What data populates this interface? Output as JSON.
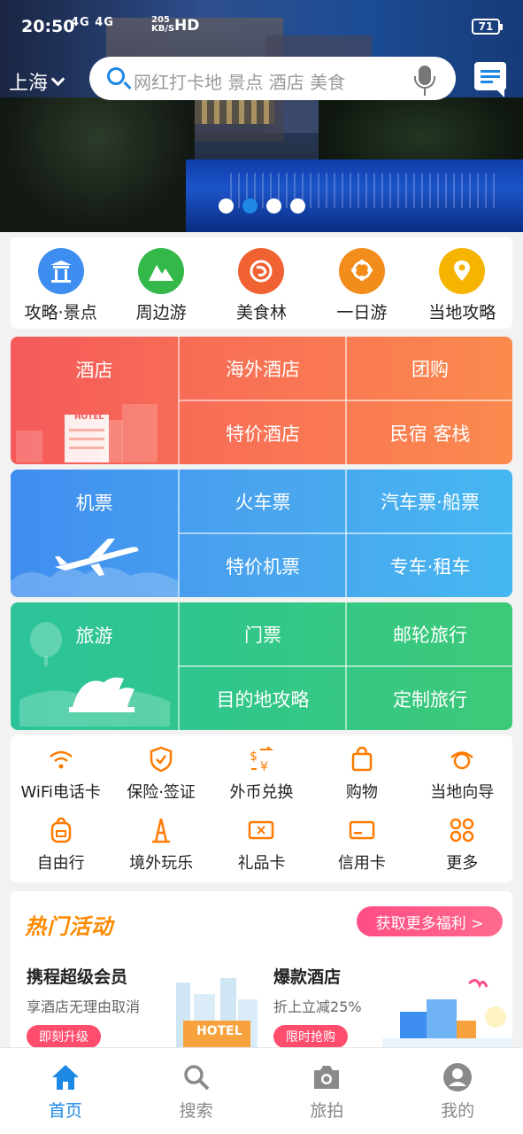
{
  "status_bar": {
    "time": "20:50",
    "network": "4G 4G",
    "speed_top": "205",
    "speed_unit": "KB/S",
    "hd": "HD",
    "battery": "71"
  },
  "header": {
    "city": "上海",
    "search_placeholder": "网红打卡地 景点 酒店 美食"
  },
  "banner": {
    "slides": 4,
    "active_index": 1
  },
  "categories": [
    {
      "label": "攻略·景点",
      "icon": "pagoda-icon",
      "color": "#3d8ef0"
    },
    {
      "label": "周边游",
      "icon": "mountain-icon",
      "color": "#35b84a"
    },
    {
      "label": "美食林",
      "icon": "shrimp-icon",
      "color": "#f06232"
    },
    {
      "label": "一日游",
      "icon": "ferris-wheel-icon",
      "color": "#f28c1b"
    },
    {
      "label": "当地攻略",
      "icon": "map-pin-icon",
      "color": "#f5b400"
    }
  ],
  "grid": {
    "hotel": {
      "main": "酒店",
      "hotel_sign": "HOTEL",
      "cells": [
        "海外酒店",
        "团购",
        "特价酒店",
        "民宿 客栈"
      ]
    },
    "flight": {
      "main": "机票",
      "cells": [
        "火车票",
        "汽车票·船票",
        "特价机票",
        "专车·租车"
      ]
    },
    "travel": {
      "main": "旅游",
      "cells": [
        "门票",
        "邮轮旅行",
        "目的地攻略",
        "定制旅行"
      ]
    }
  },
  "services": [
    {
      "label": "WiFi电话卡",
      "icon": "wifi-icon"
    },
    {
      "label": "保险·签证",
      "icon": "shield-icon"
    },
    {
      "label": "外币兑换",
      "icon": "currency-exchange-icon"
    },
    {
      "label": "购物",
      "icon": "shopping-bag-icon"
    },
    {
      "label": "当地向导",
      "icon": "guide-icon"
    },
    {
      "label": "自由行",
      "icon": "backpack-icon"
    },
    {
      "label": "境外玩乐",
      "icon": "tower-icon"
    },
    {
      "label": "礼品卡",
      "icon": "gift-card-icon"
    },
    {
      "label": "信用卡",
      "icon": "credit-card-icon"
    },
    {
      "label": "更多",
      "icon": "more-grid-icon"
    }
  ],
  "promo": {
    "title": "热门活动",
    "more": "获取更多福利 >",
    "cards": [
      {
        "title": "携程超级会员",
        "subtitle": "享酒店无理由取消",
        "button": "即刻升级",
        "image_sign": "HOTEL"
      },
      {
        "title": "爆款酒店",
        "subtitle": "折上立减25%",
        "button": "限时抢购"
      }
    ]
  },
  "bottom_nav": [
    {
      "label": "首页",
      "icon": "home-icon",
      "active": true
    },
    {
      "label": "搜索",
      "icon": "search-icon",
      "active": false
    },
    {
      "label": "旅拍",
      "icon": "camera-icon",
      "active": false
    },
    {
      "label": "我的",
      "icon": "user-icon",
      "active": false
    }
  ],
  "colors": {
    "accent": "#1e88e5",
    "hotel": "#f45a5a",
    "flight": "#3f8ef0",
    "travel": "#2cc39a",
    "service_icon": "#ff7a00"
  }
}
